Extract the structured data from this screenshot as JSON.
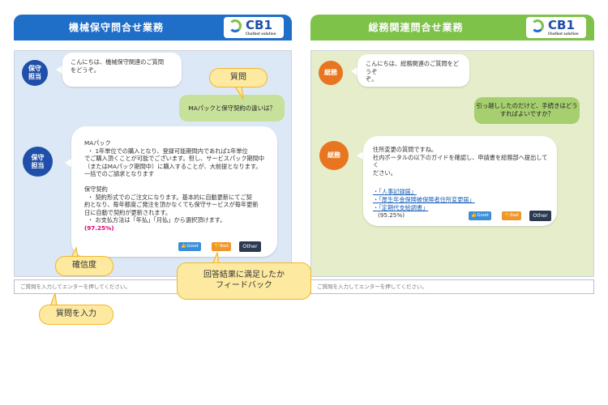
{
  "left": {
    "header_title": "機械保守問合せ業務",
    "logo_text": "CB1",
    "logo_sub": "Chatbot solution",
    "avatar_label_top": "保守",
    "avatar_label_bottom": "担当",
    "greeting_line1": "こんにちは、機械保守関連のご質問",
    "greeting_line2": "をどうぞ。",
    "user_question": "MAパックと保守契約の違いは？",
    "answer_lines": [
      "MAパック",
      "・ 1年単位での購入となり、登録可能期間内であれば1年単位",
      "でご購入頂くことが可能でございます。但し、サービスパック期間中",
      "（またはMAパック期間中）に購入することが、大前提となります。",
      "一括でのご請求となります",
      "",
      "保守契約",
      "・ 契約形式でのご注文になります。基本的に自動更新にてご契",
      "約となり、毎年都度ご発注を頂かなくても保守サービスが毎年更新",
      "日に自動で契約が更新されます。",
      "・ お支払方法は「年払」「月払」から選択頂けます。"
    ],
    "confidence": "(97.25%)",
    "btn_good": "Good",
    "btn_bad": "Bad",
    "btn_other": "Other",
    "input_placeholder": "ご質問を入力してエンターを押してください。"
  },
  "right": {
    "header_title": "総務関連問合せ業務",
    "logo_text": "CB1",
    "logo_sub": "Chatbot solution",
    "avatar_label": "総務",
    "greeting_line1": "こんにちは、総務関連のご質問をどうぞ",
    "greeting_line2": "ぞ。",
    "user_question_line1": "引っ越ししたのだけど、手続きはどう",
    "user_question_line2": "すればよいですか？",
    "answer_line1": "住所変更の質問ですね。",
    "answer_line2": "社内ポータルの以下のガイドを確認し、申請書を総務部へ提出してく",
    "answer_line3": "ださい。",
    "links": [
      "・「人事記録届」",
      "・「厚生年金保険被保険者住所変更届」",
      "・「定期代支給調書」"
    ],
    "confidence": "(95.25%)",
    "btn_good": "Good",
    "btn_bad": "Bad",
    "btn_other": "Other",
    "input_placeholder": "ご質問を入力してエンターを押してください。"
  },
  "callouts": {
    "question": "質問",
    "confidence": "確信度",
    "feedback_line1": "回答結果に満足したか",
    "feedback_line2": "フィードバック",
    "input": "質問を入力"
  },
  "colors": {
    "left_header": "#1f6fc9",
    "left_panel": "#dce8f5",
    "left_avatar": "#1f4fa8",
    "left_user_bubble": "#c7e09a",
    "right_header": "#7fc24a",
    "right_panel": "#e6edcb",
    "right_avatar": "#e8751f",
    "right_user_bubble": "#a6cf6f",
    "btn_good": "#3b8fd8",
    "btn_bad": "#f0962e",
    "btn_other": "#2b3a50",
    "callout_fill": "#fde9a0",
    "callout_border": "#f2b72b"
  }
}
